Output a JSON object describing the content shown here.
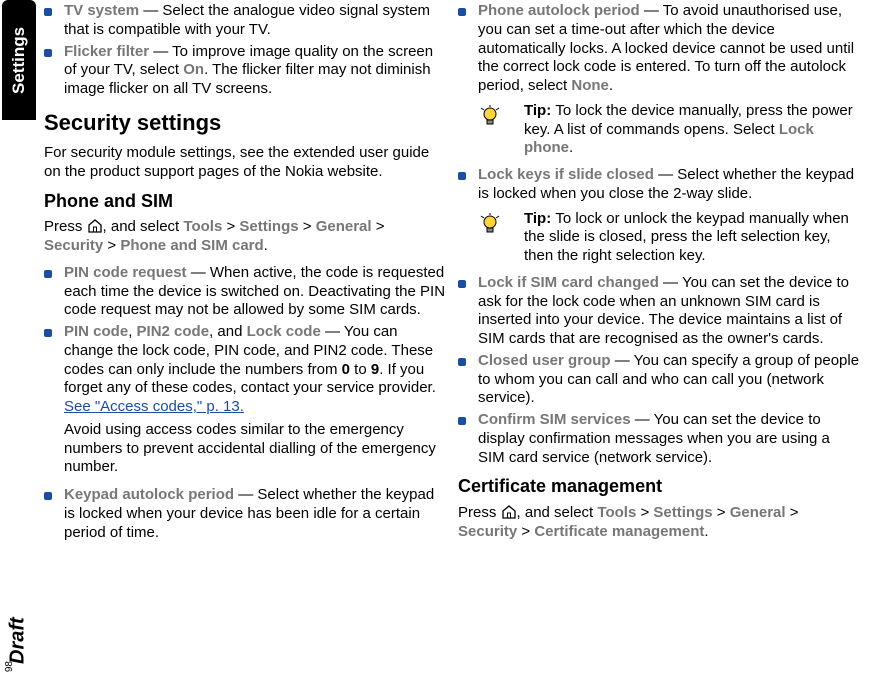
{
  "sideTab": "Settings",
  "draft": "Draft",
  "pageNumber": "98",
  "col1": {
    "initialItems": [
      {
        "term": "TV system",
        "sep": "  — ",
        "text": "Select the analogue video signal system that is compatible with your TV."
      },
      {
        "term": "Flicker filter",
        "sep": "  — ",
        "text_a": "To improve image quality on the screen of your TV, select ",
        "ui": "On",
        "text_b": ". The flicker filter may not diminish image flicker on all TV screens."
      }
    ],
    "h2": "Security settings",
    "intro": "For security module settings, see the extended user guide on the product support pages of the Nokia website.",
    "h3": "Phone and SIM",
    "nav": {
      "prefix": "Press ",
      "after_icon": ", and select ",
      "p1": "Tools",
      "gt": " > ",
      "p2": "Settings",
      "p3": "General",
      "p4": "Security",
      "p5": "Phone and SIM card",
      "end": "."
    },
    "items": [
      {
        "term": "PIN code request",
        "sep": " — ",
        "text": "When active, the code is requested each time the device is switched on. Deactivating the PIN code request may not be allowed by some SIM cards."
      },
      {
        "term_a": "PIN code",
        "comma1": ", ",
        "term_b": "PIN2 code",
        "mid": ", and ",
        "term_c": "Lock code",
        "sep": " — ",
        "text_a": "You can change the lock code, PIN code, and PIN2 code. These codes can only include the numbers from ",
        "b1": "0",
        "text_b": " to ",
        "b2": "9",
        "text_c": ". If you forget any of these codes, contact your service provider. ",
        "link": "See \"Access codes,\" p. 13.",
        "extra": "Avoid using access codes similar to the emergency numbers to prevent accidental dialling of the emergency number."
      },
      {
        "term": "Keypad autolock period",
        "sep": " — ",
        "text": "Select whether the keypad is locked when your device has been idle for a certain period of time."
      }
    ]
  },
  "col2": {
    "items1": [
      {
        "term": "Phone autolock period",
        "sep": " — ",
        "text_a": "To avoid unauthorised use, you can set a time-out after which the device automatically locks. A locked device cannot be used until the correct lock code is entered. To turn off the autolock period, select ",
        "ui": "None",
        "text_b": "."
      }
    ],
    "tip1": {
      "label": "Tip: ",
      "text_a": "To lock the device manually, press the power key. A list of commands opens. Select ",
      "ui": "Lock phone",
      "text_b": "."
    },
    "items2": [
      {
        "term": "Lock keys if slide closed",
        "sep": " — ",
        "text": "Select whether the keypad is locked when you close the 2-way slide."
      }
    ],
    "tip2": {
      "label": "Tip: ",
      "text": "To lock or unlock the keypad manually when the slide is closed, press the left selection key, then the right selection key."
    },
    "items3": [
      {
        "term": "Lock if SIM card changed",
        "sep": " — ",
        "text": "You can set the device to ask for the lock code when an unknown SIM card is inserted into your device. The device maintains a list of SIM cards that are recognised as the owner's cards."
      },
      {
        "term": "Closed user group",
        "sep": " — ",
        "text": "You can specify a group of people to whom you can call and who can call you (network service)."
      },
      {
        "term": "Confirm SIM services",
        "sep": " — ",
        "text": "You can set the device to display confirmation messages when you are using a SIM card service (network service)."
      }
    ],
    "h3": "Certificate management",
    "nav": {
      "prefix": "Press ",
      "after_icon": ", and select ",
      "p1": "Tools",
      "gt": " > ",
      "p2": "Settings",
      "p3": "General",
      "p4": "Security",
      "p5": "Certificate management",
      "end": "."
    }
  }
}
